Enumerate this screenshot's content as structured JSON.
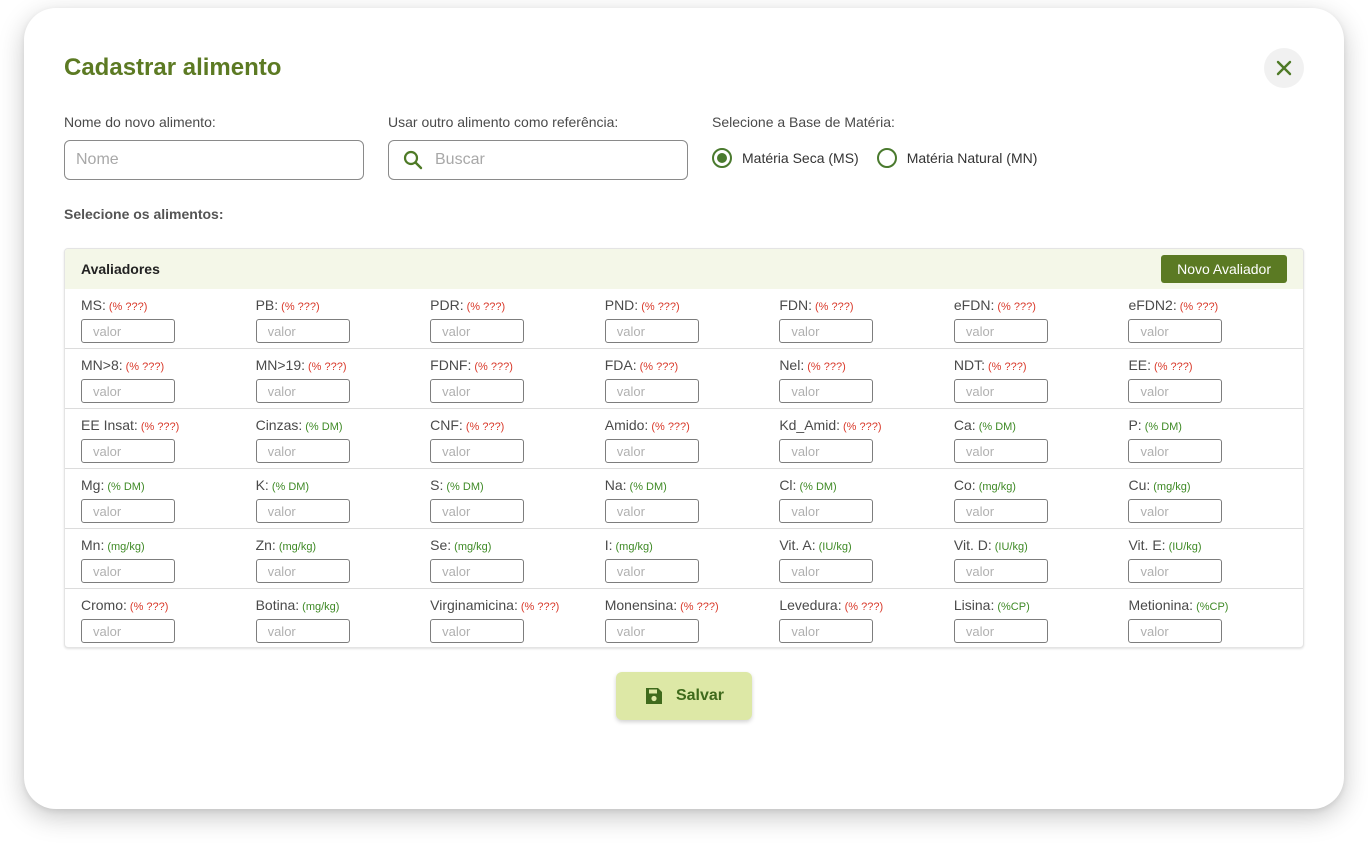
{
  "modal": {
    "title": "Cadastrar alimento"
  },
  "form": {
    "name_label": "Nome do novo alimento:",
    "name_placeholder": "Nome",
    "reference_label": "Usar outro alimento como referência:",
    "reference_placeholder": "Buscar",
    "base_label": "Selecione a Base de Matéria:",
    "base_options": [
      {
        "label": "Matéria Seca (MS)",
        "selected": true
      },
      {
        "label": "Matéria Natural (MN)",
        "selected": false
      }
    ],
    "foods_label": "Selecione os alimentos:"
  },
  "panel": {
    "title": "Avaliadores",
    "new_button_label": "Novo Avaliador",
    "input_placeholder": "valor",
    "rows": [
      [
        {
          "name": "MS:",
          "unit": "(% ???)",
          "unit_status": "warning"
        },
        {
          "name": "PB:",
          "unit": "(% ???)",
          "unit_status": "warning"
        },
        {
          "name": "PDR:",
          "unit": "(% ???)",
          "unit_status": "warning"
        },
        {
          "name": "PND:",
          "unit": "(% ???)",
          "unit_status": "warning"
        },
        {
          "name": "FDN:",
          "unit": "(% ???)",
          "unit_status": "warning"
        },
        {
          "name": "eFDN:",
          "unit": "(% ???)",
          "unit_status": "warning"
        },
        {
          "name": "eFDN2:",
          "unit": "(% ???)",
          "unit_status": "warning"
        }
      ],
      [
        {
          "name": "MN>8:",
          "unit": "(% ???)",
          "unit_status": "warning"
        },
        {
          "name": "MN>19:",
          "unit": "(% ???)",
          "unit_status": "warning"
        },
        {
          "name": "FDNF:",
          "unit": "(% ???)",
          "unit_status": "warning"
        },
        {
          "name": "FDA:",
          "unit": "(% ???)",
          "unit_status": "warning"
        },
        {
          "name": "Nel:",
          "unit": "(% ???)",
          "unit_status": "warning"
        },
        {
          "name": "NDT:",
          "unit": "(% ???)",
          "unit_status": "warning"
        },
        {
          "name": "EE:",
          "unit": "(% ???)",
          "unit_status": "warning"
        }
      ],
      [
        {
          "name": "EE Insat:",
          "unit": "(% ???)",
          "unit_status": "warning"
        },
        {
          "name": "Cinzas:",
          "unit": "(% DM)",
          "unit_status": "ok"
        },
        {
          "name": "CNF:",
          "unit": "(% ???)",
          "unit_status": "warning"
        },
        {
          "name": "Amido:",
          "unit": "(% ???)",
          "unit_status": "warning"
        },
        {
          "name": "Kd_Amid:",
          "unit": "(% ???)",
          "unit_status": "warning"
        },
        {
          "name": "Ca:",
          "unit": "(% DM)",
          "unit_status": "ok"
        },
        {
          "name": "P:",
          "unit": "(% DM)",
          "unit_status": "ok"
        }
      ],
      [
        {
          "name": "Mg:",
          "unit": "(% DM)",
          "unit_status": "ok"
        },
        {
          "name": "K:",
          "unit": "(% DM)",
          "unit_status": "ok"
        },
        {
          "name": "S:",
          "unit": "(% DM)",
          "unit_status": "ok"
        },
        {
          "name": "Na:",
          "unit": "(% DM)",
          "unit_status": "ok"
        },
        {
          "name": "Cl:",
          "unit": "(% DM)",
          "unit_status": "ok"
        },
        {
          "name": "Co:",
          "unit": "(mg/kg)",
          "unit_status": "ok"
        },
        {
          "name": "Cu:",
          "unit": "(mg/kg)",
          "unit_status": "ok"
        }
      ],
      [
        {
          "name": "Mn:",
          "unit": "(mg/kg)",
          "unit_status": "ok"
        },
        {
          "name": "Zn:",
          "unit": "(mg/kg)",
          "unit_status": "ok"
        },
        {
          "name": "Se:",
          "unit": "(mg/kg)",
          "unit_status": "ok"
        },
        {
          "name": "I:",
          "unit": "(mg/kg)",
          "unit_status": "ok"
        },
        {
          "name": "Vit. A:",
          "unit": "(IU/kg)",
          "unit_status": "ok"
        },
        {
          "name": "Vit. D:",
          "unit": "(IU/kg)",
          "unit_status": "ok"
        },
        {
          "name": "Vit. E:",
          "unit": "(IU/kg)",
          "unit_status": "ok"
        }
      ],
      [
        {
          "name": "Cromo:",
          "unit": "(% ???)",
          "unit_status": "warning"
        },
        {
          "name": "Botina:",
          "unit": "(mg/kg)",
          "unit_status": "ok"
        },
        {
          "name": "Virginamicina:",
          "unit": "(% ???)",
          "unit_status": "warning"
        },
        {
          "name": "Monensina:",
          "unit": "(% ???)",
          "unit_status": "warning"
        },
        {
          "name": "Levedura:",
          "unit": "(% ???)",
          "unit_status": "warning"
        },
        {
          "name": "Lisina:",
          "unit": "(%CP)",
          "unit_status": "ok"
        },
        {
          "name": "Metionina:",
          "unit": "(%CP)",
          "unit_status": "ok"
        }
      ]
    ]
  },
  "actions": {
    "save_label": "Salvar"
  },
  "colors": {
    "brand": "#5b7a23",
    "warning_unit": "#d93a2b",
    "ok_unit": "#3f8a26",
    "save_button_bg": "#dde8a6"
  },
  "icons": {
    "close": "close-icon",
    "search": "search-icon",
    "save": "save-icon"
  }
}
